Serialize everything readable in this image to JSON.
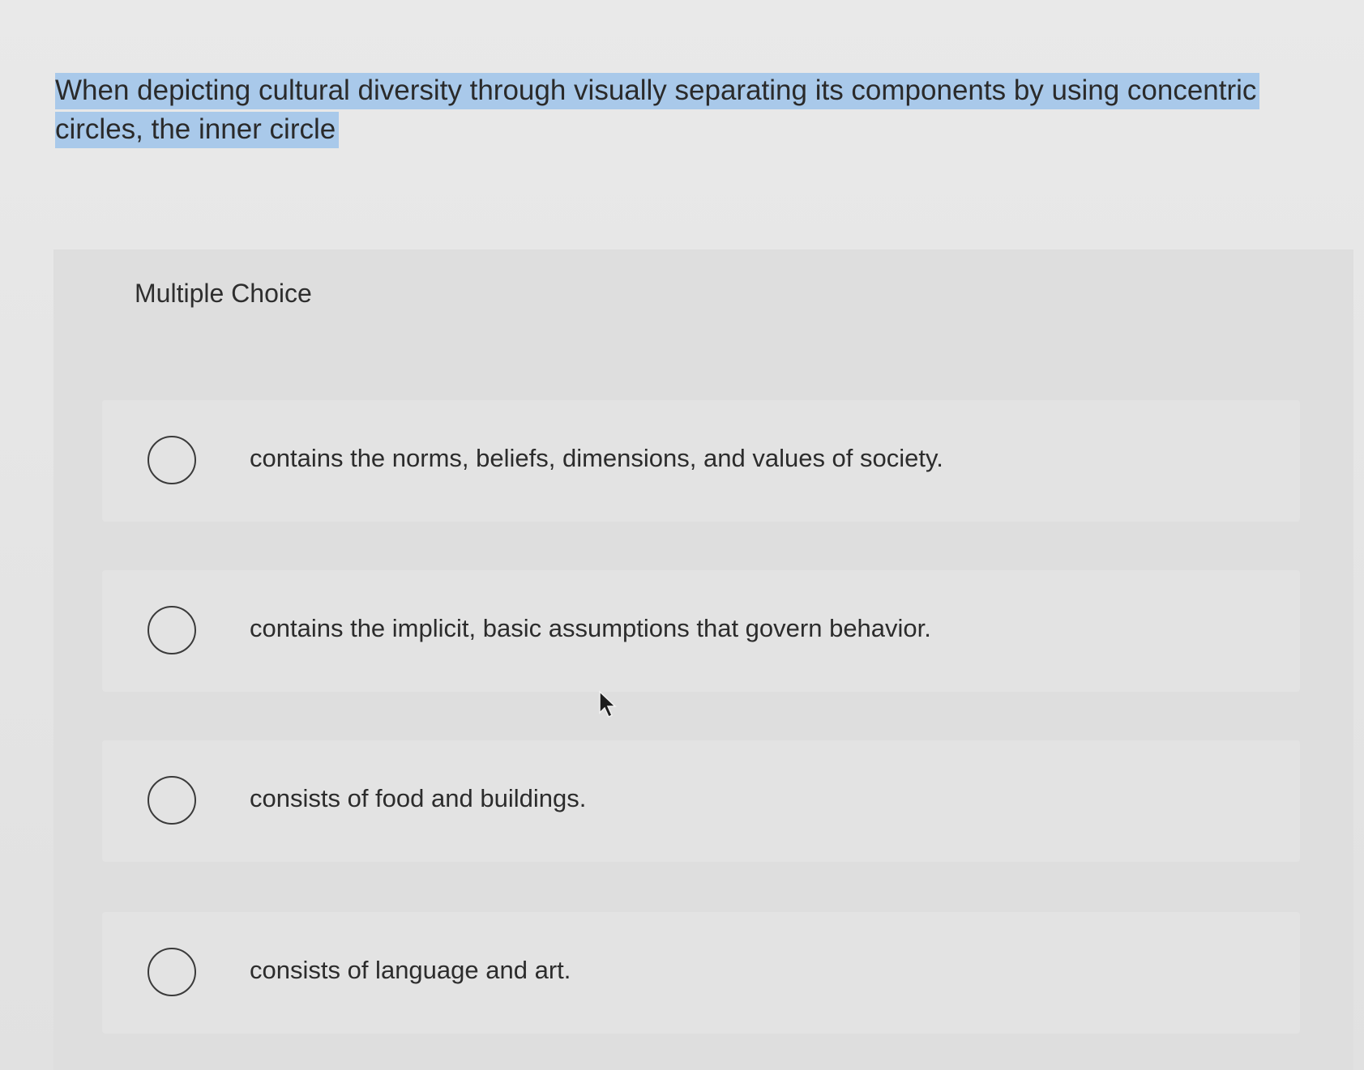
{
  "question": {
    "text": "When depicting cultural diversity through visually separating its components by using concentric circles, the inner circle"
  },
  "choices": {
    "section_label": "Multiple Choice",
    "options": [
      {
        "label": "contains the norms, beliefs, dimensions, and values of society.",
        "selected": false
      },
      {
        "label": "contains the implicit, basic assumptions that govern behavior.",
        "selected": false
      },
      {
        "label": "consists of food and buildings.",
        "selected": false
      },
      {
        "label": "consists of language and art.",
        "selected": false
      }
    ]
  },
  "icons": {
    "radio": "radio-unchecked-icon",
    "cursor": "mouse-pointer-icon"
  },
  "colors": {
    "highlight": "#a9c9ea",
    "background": "#e6e6e6",
    "panel": "#dedede",
    "option_card": "#e3e3e3"
  }
}
